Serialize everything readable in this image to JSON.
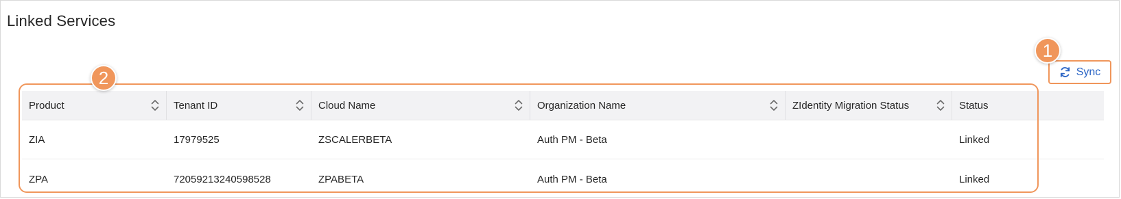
{
  "page": {
    "title": "Linked Services"
  },
  "sync": {
    "label": "Sync",
    "icon": "refresh-icon",
    "color": "#2a64c5"
  },
  "callouts": [
    {
      "label": "1"
    },
    {
      "label": "2"
    }
  ],
  "accent_color": "#f0965b",
  "table": {
    "columns": [
      {
        "label": "Product",
        "sortable": true
      },
      {
        "label": "Tenant ID",
        "sortable": true
      },
      {
        "label": "Cloud Name",
        "sortable": true
      },
      {
        "label": "Organization Name",
        "sortable": true
      },
      {
        "label": "ZIdentity Migration Status",
        "sortable": true
      },
      {
        "label": "Status",
        "sortable": false
      }
    ],
    "rows": [
      {
        "product": "ZIA",
        "tenant_id": "17979525",
        "cloud_name": "ZSCALERBETA",
        "organization_name": "Auth PM - Beta",
        "migration_status": "",
        "status": "Linked"
      },
      {
        "product": "ZPA",
        "tenant_id": "72059213240598528",
        "cloud_name": "ZPABETA",
        "organization_name": "Auth PM - Beta",
        "migration_status": "",
        "status": "Linked"
      }
    ]
  }
}
